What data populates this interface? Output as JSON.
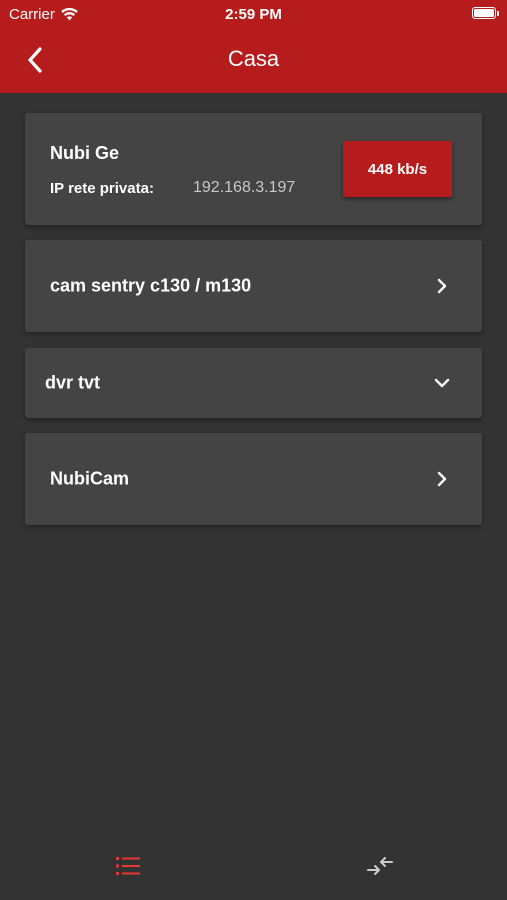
{
  "status_bar": {
    "carrier": "Carrier",
    "time": "2:59 PM",
    "battery_level": 1.0
  },
  "header": {
    "title": "Casa",
    "back_icon": "chevron-left-icon"
  },
  "device": {
    "name": "Nubi Ge",
    "ip_label": "IP rete privata:",
    "ip_value": "192.168.3.197",
    "speed": "448 kb/s"
  },
  "rows": [
    {
      "label": "cam sentry c130 / m130",
      "icon": "chevron-right-icon"
    },
    {
      "label": "dvr tvt",
      "icon": "chevron-down-icon"
    },
    {
      "label": "NubiCam",
      "icon": "chevron-right-icon"
    }
  ],
  "tab_bar": {
    "list_icon": "list-icon",
    "swap_icon": "swap-arrows-icon",
    "active_color": "#e53935",
    "inactive_color": "#cccccc"
  },
  "colors": {
    "header": "#b71c1c",
    "background": "#333333",
    "card": "#444444",
    "badge": "#b71c1c"
  }
}
